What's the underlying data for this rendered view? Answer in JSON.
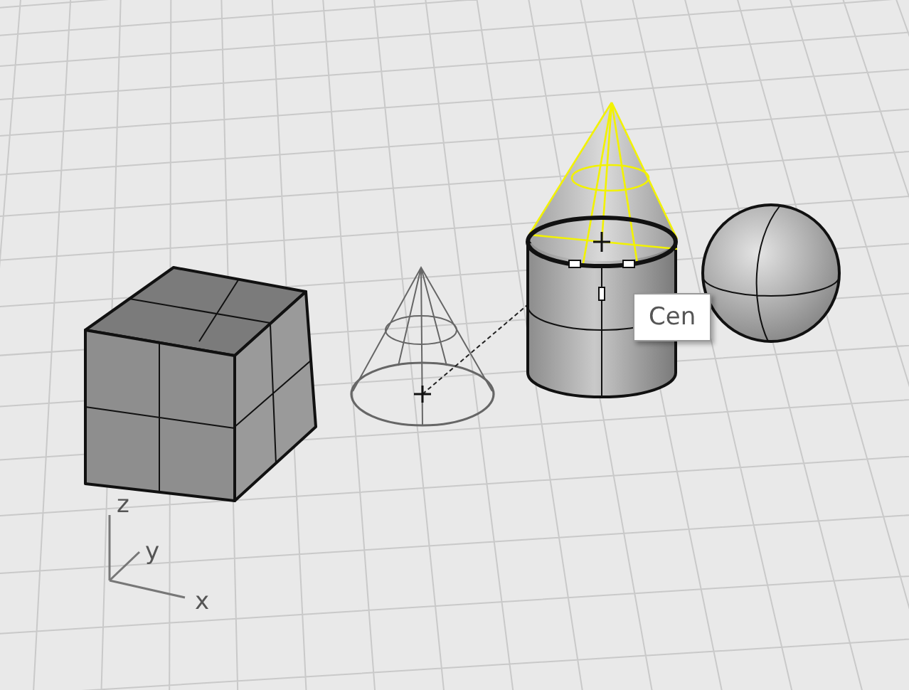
{
  "viewport": {
    "tooltip": "Cen",
    "axes": [
      {
        "label": "z"
      },
      {
        "label": "y"
      },
      {
        "label": "x"
      }
    ]
  }
}
